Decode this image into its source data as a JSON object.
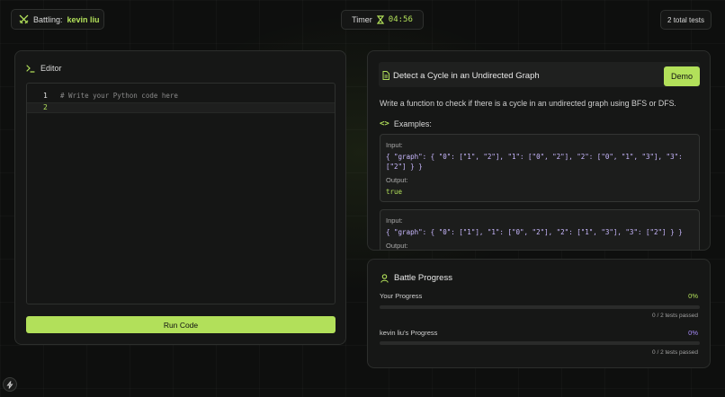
{
  "header": {
    "battling_label": "Battling:",
    "opponent": "kevin liu",
    "timer_label": "Timer",
    "timer_value": "04:56",
    "tests_total": "2 total tests"
  },
  "editor": {
    "title": "Editor",
    "line_numbers": [
      "1",
      "2"
    ],
    "code_line_1": "# Write your Python code here",
    "run_label": "Run Code"
  },
  "problem": {
    "title": "Detect a Cycle in an Undirected Graph",
    "demo_label": "Demo",
    "description": "Write a function to check if there is a cycle in an undirected graph using BFS or DFS.",
    "examples_label": "Examples:",
    "examples": [
      {
        "input_label": "Input:",
        "input_line1": "{ \"graph\": { \"0\": [\"1\", \"2\"], \"1\": [\"0\", \"2\"], \"2\": [\"0\", \"1\", \"3\"], \"3\":",
        "input_line2": "[\"2\"] } }",
        "output_label": "Output:",
        "output": "true"
      },
      {
        "input_label": "Input:",
        "input_line1": "{ \"graph\": { \"0\": [\"1\"], \"1\": [\"0\", \"2\"], \"2\": [\"1\", \"3\"], \"3\": [\"2\"] } }",
        "output_label": "Output:"
      }
    ]
  },
  "progress": {
    "title": "Battle Progress",
    "you_label": "Your Progress",
    "you_pct": "0%",
    "you_fraction": 0,
    "you_tests": "0 / 2 tests passed",
    "opp_label": "kevin liu's Progress",
    "opp_pct": "0%",
    "opp_fraction": 0,
    "opp_tests": "0 / 2 tests passed"
  },
  "icons": {
    "battle": "crossed-swords-icon",
    "timer": "hourglass-icon",
    "editor": "terminal-icon",
    "problem": "document-icon",
    "examples": "code-brackets-icon",
    "progress": "user-icon",
    "bottom": "lightning-icon"
  },
  "colors": {
    "accent": "#b2e05a",
    "opponent": "#a78bfa",
    "background": "#0e0f0e"
  }
}
